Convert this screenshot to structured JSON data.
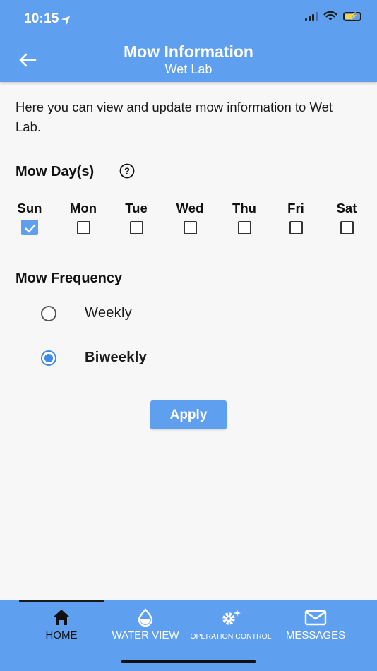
{
  "status_bar": {
    "time": "10:15"
  },
  "header": {
    "title": "Mow Information",
    "subtitle": "Wet Lab",
    "back_icon": "arrow-left-icon"
  },
  "intro_text": "Here you can view and update mow information to Wet Lab.",
  "mow_days": {
    "label": "Mow Day(s)",
    "help_icon": "question-circle-icon",
    "days": [
      {
        "label": "Sun",
        "checked": true
      },
      {
        "label": "Mon",
        "checked": false
      },
      {
        "label": "Tue",
        "checked": false
      },
      {
        "label": "Wed",
        "checked": false
      },
      {
        "label": "Thu",
        "checked": false
      },
      {
        "label": "Fri",
        "checked": false
      },
      {
        "label": "Sat",
        "checked": false
      }
    ]
  },
  "mow_frequency": {
    "label": "Mow Frequency",
    "options": [
      {
        "label": "Weekly",
        "selected": false
      },
      {
        "label": "Biweekly",
        "selected": true
      }
    ]
  },
  "apply_label": "Apply",
  "colors": {
    "primary": "#5f9ff0",
    "radio_selected": "#3d8ae8",
    "background": "#f7f7f7"
  },
  "bottom_nav": {
    "items": [
      {
        "label": "HOME",
        "icon": "home-icon",
        "active": true
      },
      {
        "label": "WATER VIEW",
        "icon": "water-drop-icon",
        "active": false
      },
      {
        "label": "OPERATION CONTROL",
        "icon": "gear-sparkle-icon",
        "active": false
      },
      {
        "label": "MESSAGES",
        "icon": "envelope-icon",
        "active": false
      }
    ]
  }
}
